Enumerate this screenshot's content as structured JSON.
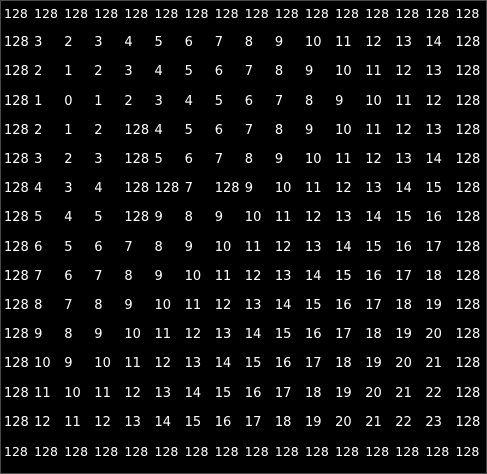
{
  "distance_grid": {
    "rows": [
      [
        "128",
        "128",
        "128",
        "128",
        "128",
        "128",
        "128",
        "128",
        "128",
        "128",
        "128",
        "128",
        "128",
        "128",
        "128",
        "128"
      ],
      [
        "128",
        "3",
        "2",
        "3",
        "4",
        "5",
        "6",
        "7",
        "8",
        "9",
        "10",
        "11",
        "12",
        "13",
        "14",
        "128"
      ],
      [
        "128",
        "2",
        "1",
        "2",
        "3",
        "4",
        "5",
        "6",
        "7",
        "8",
        "9",
        "10",
        "11",
        "12",
        "13",
        "128"
      ],
      [
        "128",
        "1",
        "0",
        "1",
        "2",
        "3",
        "4",
        "5",
        "6",
        "7",
        "8",
        "9",
        "10",
        "11",
        "12",
        "128"
      ],
      [
        "128",
        "2",
        "1",
        "2",
        "128",
        "4",
        "5",
        "6",
        "7",
        "8",
        "9",
        "10",
        "11",
        "12",
        "13",
        "128"
      ],
      [
        "128",
        "3",
        "2",
        "3",
        "128",
        "5",
        "6",
        "7",
        "8",
        "9",
        "10",
        "11",
        "12",
        "13",
        "14",
        "128"
      ],
      [
        "128",
        "4",
        "3",
        "4",
        "128",
        "128",
        "7",
        "128",
        "9",
        "10",
        "11",
        "12",
        "13",
        "14",
        "15",
        "128"
      ],
      [
        "128",
        "5",
        "4",
        "5",
        "128",
        "9",
        "8",
        "9",
        "10",
        "11",
        "12",
        "13",
        "14",
        "15",
        "16",
        "128"
      ],
      [
        "128",
        "6",
        "5",
        "6",
        "7",
        "8",
        "9",
        "10",
        "11",
        "12",
        "13",
        "14",
        "15",
        "16",
        "17",
        "128"
      ],
      [
        "128",
        "7",
        "6",
        "7",
        "8",
        "9",
        "10",
        "11",
        "12",
        "13",
        "14",
        "15",
        "16",
        "17",
        "18",
        "128"
      ],
      [
        "128",
        "8",
        "7",
        "8",
        "9",
        "10",
        "11",
        "12",
        "13",
        "14",
        "15",
        "16",
        "17",
        "18",
        "19",
        "128"
      ],
      [
        "128",
        "9",
        "8",
        "9",
        "10",
        "11",
        "12",
        "13",
        "14",
        "15",
        "16",
        "17",
        "18",
        "19",
        "20",
        "128"
      ],
      [
        "128",
        "10",
        "9",
        "10",
        "11",
        "12",
        "13",
        "14",
        "15",
        "16",
        "17",
        "18",
        "19",
        "20",
        "21",
        "128"
      ],
      [
        "128",
        "11",
        "10",
        "11",
        "12",
        "13",
        "14",
        "15",
        "16",
        "17",
        "18",
        "19",
        "20",
        "21",
        "22",
        "128"
      ],
      [
        "128",
        "12",
        "11",
        "12",
        "13",
        "14",
        "15",
        "16",
        "17",
        "18",
        "19",
        "20",
        "21",
        "22",
        "23",
        "128"
      ],
      [
        "128",
        "128",
        "128",
        "128",
        "128",
        "128",
        "128",
        "128",
        "128",
        "128",
        "128",
        "128",
        "128",
        "128",
        "128",
        "128"
      ]
    ]
  },
  "colors": {
    "background": "#000000",
    "text": "#ffffff",
    "border": "#4a4a4a"
  }
}
